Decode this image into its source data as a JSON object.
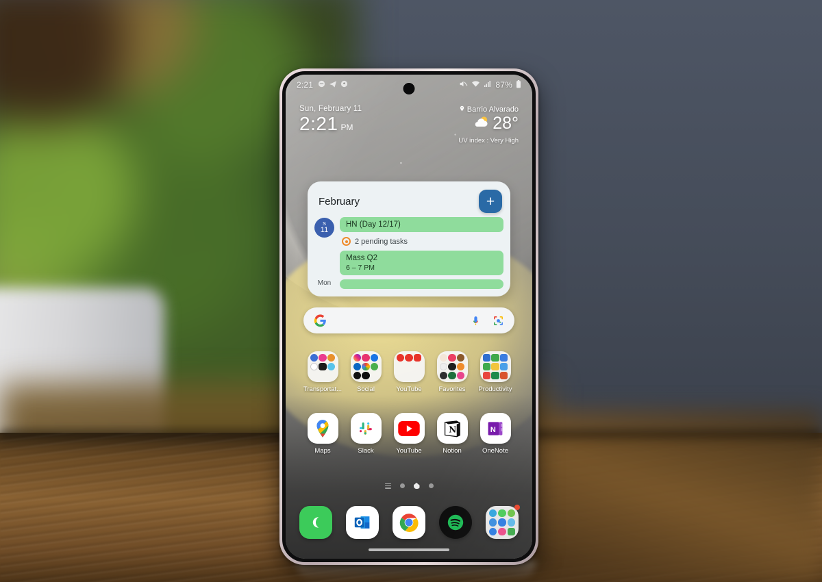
{
  "scene": {
    "description": "Samsung Galaxy phone standing on a wooden table, blurred plant on left and gray wall behind",
    "colors": {
      "wall": "#454c59",
      "table": "#8a6233",
      "plant_green": "#4a7028",
      "phone_frame": "#e6d9da"
    }
  },
  "phone": {
    "status_bar": {
      "clock": "2:21",
      "left_icons": [
        "mute-badge-icon",
        "telegram-icon",
        "football-icon"
      ],
      "right_icons": [
        "volume-mute-icon",
        "wifi-icon",
        "signal-icon"
      ],
      "battery_percent": "87%",
      "battery_icon": "battery-icon"
    },
    "info": {
      "date": "Sun, February 11",
      "time": "2:21",
      "ampm": "PM",
      "location": "Barrio Alvarado",
      "location_icon": "location-pin-icon",
      "weather_icon": "partly-cloudy-icon",
      "temperature": "28°",
      "uv_index": "UV index : Very High"
    },
    "calendar_widget": {
      "month": "February",
      "add_label": "+",
      "day_chip": {
        "weekday": "S",
        "day": "11"
      },
      "events": [
        {
          "title": "HN (Day 12/17)",
          "time": ""
        },
        {
          "title": "Mass Q2",
          "time": "6 – 7 PM"
        }
      ],
      "task_line": "2 pending tasks",
      "task_icon": "task-circle-icon",
      "next_day_label": "Mon",
      "accent_event": "#8fdc9c",
      "accent_chip": "#3a5fae",
      "accent_add": "#2a6aa6"
    },
    "search_bar": {
      "logo_icon": "google-g-icon",
      "mic_icon": "microphone-icon",
      "lens_icon": "google-lens-icon",
      "placeholder": ""
    },
    "folder_row": [
      {
        "label": "Transportat...",
        "icon": "folder-icon",
        "mini_colors": [
          "#3b6fd4",
          "#ea3c8f",
          "#e8912c",
          "#ffffff",
          "#1b1b1b",
          "#58c3ea",
          "",
          "",
          ""
        ]
      },
      {
        "label": "Social",
        "icon": "folder-icon",
        "mini_colors": [
          "#d8337e",
          "#e8336f",
          "#1b74e4",
          "#0a66c2",
          "#f2b705",
          "#4aaf4d",
          "#111111",
          "#0d0d0d",
          ""
        ]
      },
      {
        "label": "YouTube",
        "icon": "folder-icon",
        "mini_colors": [
          "#e8342a",
          "#e8342a",
          "#e8342a",
          "",
          "",
          "",
          "",
          "",
          ""
        ]
      },
      {
        "label": "Favorites",
        "icon": "folder-icon",
        "mini_colors": [
          "#f4e6d8",
          "#ec3f63",
          "#8b5a2b",
          "#eeeeee",
          "#1f1f1f",
          "#ef8c2b",
          "#2e2e2e",
          "#1f6f3c",
          "#e8458c"
        ]
      },
      {
        "label": "Productivity",
        "icon": "folder-icon",
        "mini_colors": [
          "#2f6fd0",
          "#3fa94b",
          "#3b7de0",
          "#3fa94b",
          "#f2c53d",
          "#4aa0e8",
          "#e8453c",
          "#1e8a4c",
          "#d9522b"
        ]
      }
    ],
    "app_row": [
      {
        "label": "Maps",
        "icon": "google-maps-icon"
      },
      {
        "label": "Slack",
        "icon": "slack-icon"
      },
      {
        "label": "YouTube",
        "icon": "youtube-icon"
      },
      {
        "label": "Notion",
        "icon": "notion-icon"
      },
      {
        "label": "OneNote",
        "icon": "onenote-icon"
      }
    ],
    "page_indicator": {
      "items": [
        "list-icon",
        "dot",
        "home-icon",
        "dot"
      ],
      "active_index": 2
    },
    "dock": [
      {
        "label": "Phone",
        "icon": "phone-icon",
        "badge": ""
      },
      {
        "label": "Outlook",
        "icon": "outlook-icon",
        "badge": ""
      },
      {
        "label": "Chrome",
        "icon": "chrome-icon",
        "badge": ""
      },
      {
        "label": "Spotify",
        "icon": "spotify-icon",
        "badge": ""
      },
      {
        "label": "Messaging folder",
        "icon": "folder-icon",
        "badge": "1",
        "mini_colors": [
          "#34a5dd",
          "#4aca5a",
          "#6cc24a",
          "#3b8ede",
          "#2f7de0",
          "#5fb8e8",
          "#2f7de0",
          "#ea4c89",
          "#3fa94b"
        ]
      }
    ],
    "nav_bar": "gesture-handle"
  }
}
